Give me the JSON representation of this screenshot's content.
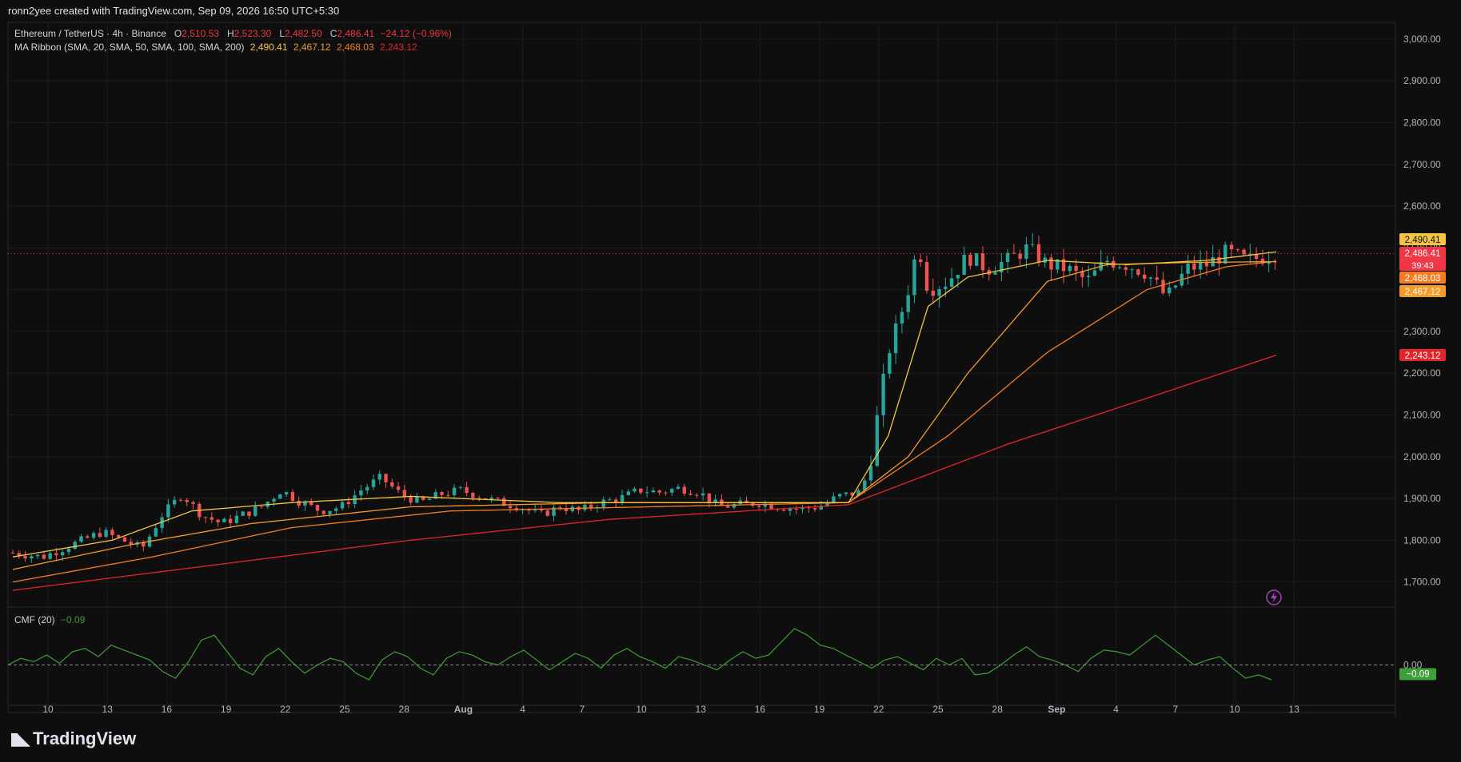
{
  "header": {
    "caption": "ronn2yee created with TradingView.com, Sep 09, 2026 16:50 UTC+5:30"
  },
  "legend": {
    "symbol": "Ethereum / TetherUS · 4h · Binance",
    "o_label": "O",
    "o_value": "2,510.53",
    "h_label": "H",
    "h_value": "2,523.30",
    "l_label": "L",
    "l_value": "2,482.50",
    "c_label": "C",
    "c_value": "2,486.41",
    "change": "−24.12 (−0.96%)",
    "ma_label": "MA Ribbon (SMA, 20, SMA, 50, SMA, 100, SMA, 200)",
    "ma_values": [
      "2,490.41",
      "2,467.12",
      "2,468.03",
      "2,243.12"
    ],
    "cmf_label": "CMF (20)",
    "cmf_value": "−0.09"
  },
  "branding": {
    "name": "TradingView"
  },
  "colors": {
    "background": "#0e0e0e",
    "grid": "#1c1c1c",
    "up": "#26a69a",
    "down": "#ef5350",
    "sma20": "#f5c542",
    "sma50": "#f59b2a",
    "sma100": "#f57c1f",
    "sma200": "#e3242b",
    "cmf": "#3f9e37",
    "current_price": "#f23645"
  },
  "chart_data": [
    {
      "type": "candlestick",
      "title": "Ethereum / TetherUS · 4h · Binance",
      "x_ticks": [
        "10",
        "13",
        "16",
        "19",
        "22",
        "25",
        "28",
        "Aug",
        "4",
        "7",
        "10",
        "13",
        "16",
        "19",
        "22",
        "25",
        "28",
        "Sep",
        "4",
        "7",
        "10",
        "13"
      ],
      "y_ticks": [
        "1,700.00",
        "1,800.00",
        "1,900.00",
        "2,000.00",
        "2,100.00",
        "2,200.00",
        "2,300.00",
        "2,400.00",
        "2,500.00",
        "2,600.00",
        "2,700.00",
        "2,800.00",
        "2,900.00",
        "3,000.00"
      ],
      "ylim": [
        1640,
        3040
      ],
      "last_close": 2486.41,
      "price_badges": [
        {
          "label": "2,490.41",
          "value": 2490.41,
          "color": "#f5c542"
        },
        {
          "label": "2,486.41",
          "value": 2486.41,
          "color": "#f23645",
          "sub": "39:43"
        },
        {
          "label": "2,468.03",
          "value": 2468.03,
          "color": "#f57c1f"
        },
        {
          "label": "2,467.12",
          "value": 2467.12,
          "color": "#f59b2a"
        },
        {
          "label": "2,243.12",
          "value": 2243.12,
          "color": "#e3242b"
        }
      ],
      "close_path": [
        [
          0,
          1770
        ],
        [
          3,
          1760
        ],
        [
          6,
          1790
        ],
        [
          9,
          1820
        ],
        [
          11,
          1800
        ],
        [
          13,
          1780
        ],
        [
          15,
          1860
        ],
        [
          17,
          1910
        ],
        [
          19,
          1860
        ],
        [
          21,
          1840
        ],
        [
          23,
          1860
        ],
        [
          25,
          1880
        ],
        [
          27,
          1920
        ],
        [
          29,
          1890
        ],
        [
          31,
          1870
        ],
        [
          33,
          1880
        ],
        [
          35,
          1920
        ],
        [
          37,
          1950
        ],
        [
          39,
          1910
        ],
        [
          41,
          1890
        ],
        [
          43,
          1910
        ],
        [
          45,
          1920
        ],
        [
          47,
          1905
        ],
        [
          49,
          1890
        ],
        [
          51,
          1880
        ],
        [
          53,
          1860
        ],
        [
          55,
          1880
        ],
        [
          57,
          1870
        ],
        [
          59,
          1890
        ],
        [
          61,
          1900
        ],
        [
          63,
          1920
        ],
        [
          65,
          1915
        ],
        [
          67,
          1925
        ],
        [
          69,
          1915
        ],
        [
          71,
          1880
        ],
        [
          73,
          1885
        ],
        [
          75,
          1890
        ],
        [
          77,
          1880
        ],
        [
          79,
          1875
        ],
        [
          81,
          1880
        ],
        [
          83,
          1905
        ],
        [
          85,
          1915
        ],
        [
          86,
          1960
        ],
        [
          87,
          2110
        ],
        [
          88,
          2250
        ],
        [
          89,
          2320
        ],
        [
          90,
          2400
        ],
        [
          91,
          2510
        ],
        [
          92,
          2400
        ],
        [
          94,
          2420
        ],
        [
          96,
          2480
        ],
        [
          98,
          2450
        ],
        [
          100,
          2470
        ],
        [
          102,
          2500
        ],
        [
          104,
          2460
        ],
        [
          106,
          2450
        ],
        [
          108,
          2420
        ],
        [
          110,
          2470
        ],
        [
          112,
          2460
        ],
        [
          114,
          2440
        ],
        [
          116,
          2380
        ],
        [
          118,
          2450
        ],
        [
          120,
          2460
        ],
        [
          122,
          2490
        ],
        [
          124,
          2470
        ],
        [
          126,
          2480
        ],
        [
          127,
          2486.41
        ]
      ],
      "sma20": [
        [
          0,
          1760
        ],
        [
          10,
          1800
        ],
        [
          18,
          1870
        ],
        [
          28,
          1890
        ],
        [
          40,
          1905
        ],
        [
          55,
          1890
        ],
        [
          70,
          1890
        ],
        [
          84,
          1890
        ],
        [
          88,
          2050
        ],
        [
          92,
          2360
        ],
        [
          96,
          2430
        ],
        [
          104,
          2470
        ],
        [
          112,
          2460
        ],
        [
          120,
          2470
        ],
        [
          127,
          2490.41
        ]
      ],
      "sma50": [
        [
          0,
          1730
        ],
        [
          12,
          1790
        ],
        [
          24,
          1840
        ],
        [
          40,
          1880
        ],
        [
          60,
          1890
        ],
        [
          84,
          1890
        ],
        [
          90,
          2000
        ],
        [
          96,
          2200
        ],
        [
          104,
          2420
        ],
        [
          110,
          2460
        ],
        [
          118,
          2465
        ],
        [
          127,
          2467.12
        ]
      ],
      "sma100": [
        [
          0,
          1700
        ],
        [
          14,
          1760
        ],
        [
          28,
          1830
        ],
        [
          44,
          1870
        ],
        [
          64,
          1880
        ],
        [
          84,
          1890
        ],
        [
          94,
          2050
        ],
        [
          104,
          2250
        ],
        [
          114,
          2400
        ],
        [
          122,
          2455
        ],
        [
          127,
          2468.03
        ]
      ],
      "sma200": [
        [
          0,
          1680
        ],
        [
          20,
          1740
        ],
        [
          40,
          1800
        ],
        [
          60,
          1850
        ],
        [
          84,
          1885
        ],
        [
          100,
          2030
        ],
        [
          114,
          2140
        ],
        [
          127,
          2243.12
        ]
      ]
    },
    {
      "type": "line",
      "title": "CMF (20)",
      "zero_label": "0.00",
      "last_value": -0.09,
      "last_label": "−0.09",
      "ylim": [
        -0.25,
        0.25
      ],
      "values": [
        0.0,
        0.04,
        0.02,
        0.06,
        0.01,
        0.08,
        0.1,
        0.05,
        0.12,
        0.09,
        0.06,
        0.03,
        -0.04,
        -0.08,
        0.02,
        0.15,
        0.18,
        0.08,
        -0.02,
        -0.06,
        0.05,
        0.1,
        0.02,
        -0.05,
        0.0,
        0.04,
        0.02,
        -0.05,
        -0.09,
        0.03,
        0.08,
        0.05,
        -0.02,
        -0.06,
        0.04,
        0.08,
        0.06,
        0.02,
        0.0,
        0.05,
        0.09,
        0.03,
        -0.03,
        0.02,
        0.07,
        0.04,
        -0.02,
        0.06,
        0.1,
        0.05,
        0.02,
        -0.02,
        0.05,
        0.03,
        0.0,
        -0.03,
        0.03,
        0.08,
        0.04,
        0.06,
        0.14,
        0.22,
        0.18,
        0.12,
        0.1,
        0.06,
        0.02,
        -0.02,
        0.03,
        0.05,
        0.01,
        -0.03,
        0.04,
        0.0,
        0.04,
        -0.06,
        -0.05,
        0.0,
        0.06,
        0.11,
        0.05,
        0.03,
        0.0,
        -0.04,
        0.04,
        0.09,
        0.08,
        0.06,
        0.12,
        0.18,
        0.12,
        0.06,
        0.0,
        0.03,
        0.05,
        -0.02,
        -0.08,
        -0.06,
        -0.09
      ]
    }
  ]
}
